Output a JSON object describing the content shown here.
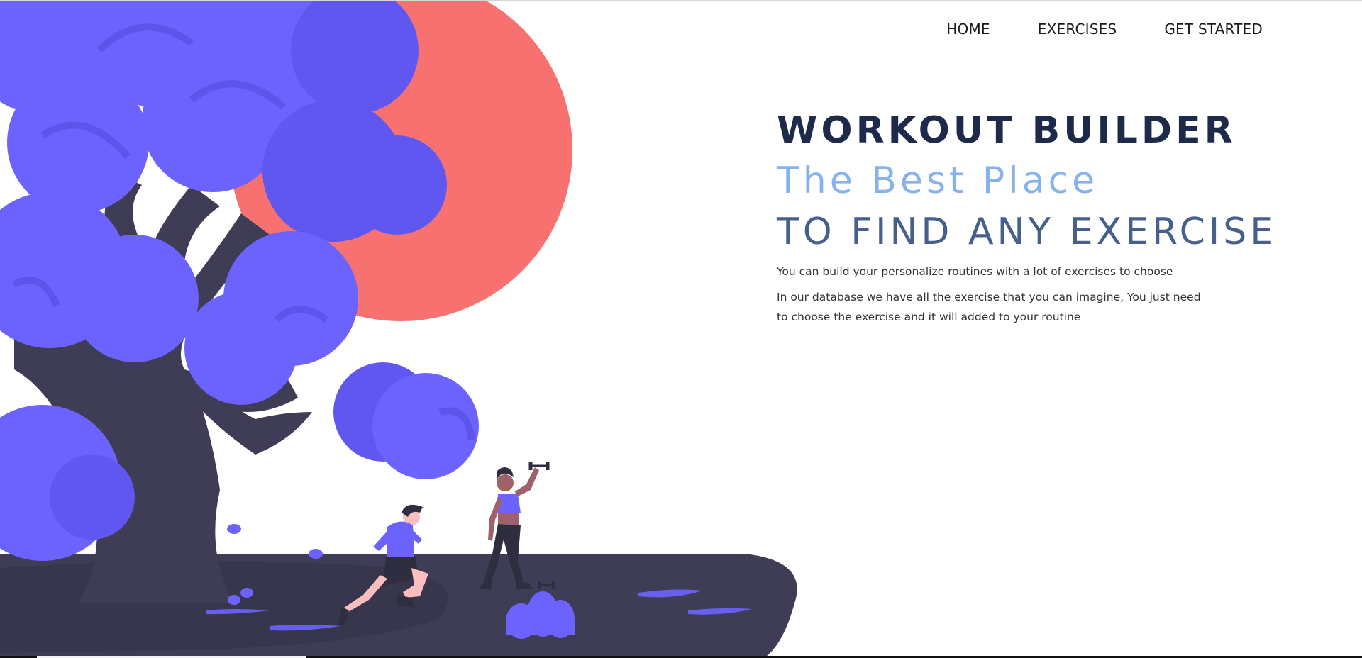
{
  "nav": {
    "items": [
      {
        "label": "HOME"
      },
      {
        "label": "EXERCISES"
      },
      {
        "label": "GET STARTED"
      }
    ]
  },
  "hero": {
    "title": "WORKOUT BUILDER",
    "tagline_1": "The Best Place",
    "tagline_2": "TO FIND ANY EXERCISE",
    "paragraph_1": "You can build your personalize routines with a lot of exercises to choose",
    "paragraph_2": "In our database we have all the exercise that you can imagine, You just need to choose the exercise and it will added to your routine"
  },
  "colors": {
    "tree_foliage": "#6c63ff",
    "tree_trunk": "#3f3d56",
    "sun": "#f87171",
    "title": "#1e2a4a",
    "tagline_light": "#86b2ee",
    "tagline_dark": "#46608d"
  },
  "illustration": {
    "name": "fitness-park-illustration",
    "elements": [
      "tree-icon",
      "sun-icon",
      "runner-man-icon",
      "woman-lifting-dumbbell-icon",
      "dumbbell-icon",
      "bush-icon"
    ]
  }
}
